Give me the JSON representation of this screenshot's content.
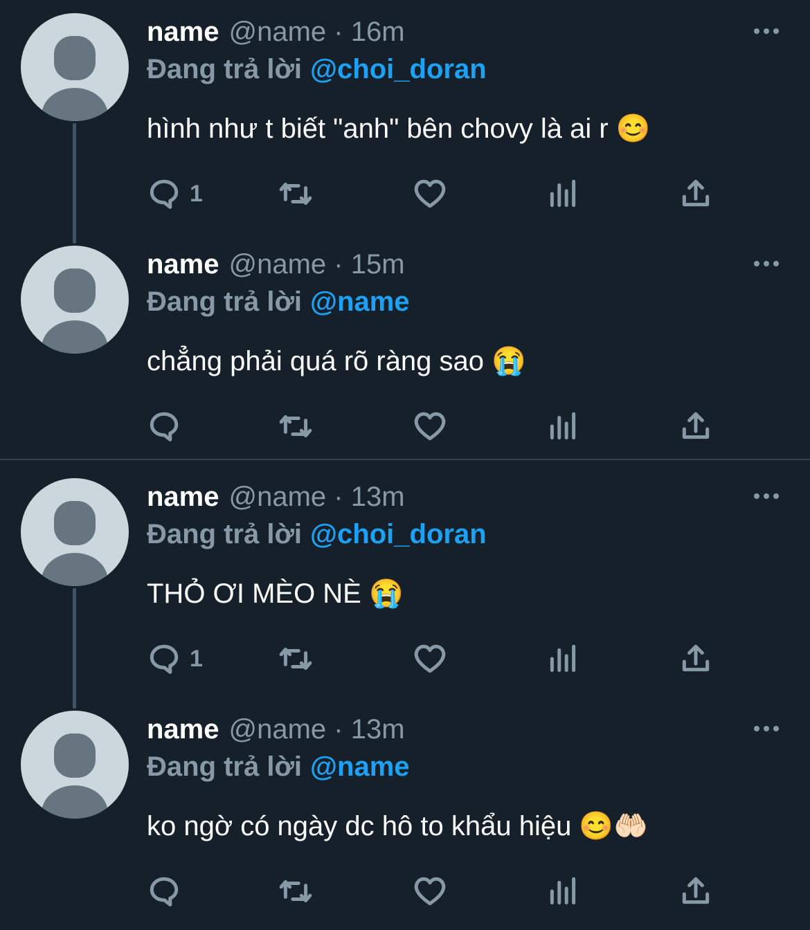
{
  "tweets": [
    {
      "name": "name",
      "meta": "@name · 16m",
      "reply_prefix": "Đang trả lời",
      "mention": "@choi_doran",
      "text": "hình như t biết \"anh\" bên chovy là ai r 😊",
      "reply_count": "1"
    },
    {
      "name": "name",
      "meta": "@name · 15m",
      "reply_prefix": "Đang trả lời",
      "mention": "@name",
      "text": "chẳng phải quá rõ ràng sao 😭",
      "reply_count": ""
    },
    {
      "name": "name",
      "meta": "@name · 13m",
      "reply_prefix": "Đang trả lời",
      "mention": "@choi_doran",
      "text": "THỎ ƠI MÈO NÈ 😭",
      "reply_count": "1"
    },
    {
      "name": "name",
      "meta": "@name · 13m",
      "reply_prefix": "Đang trả lời",
      "mention": "@name",
      "text": "ko ngờ có ngày dc hô to khẩu hiệu 😊🤲🏻",
      "reply_count": ""
    }
  ],
  "icons": {
    "reply": "reply-icon",
    "retweet": "retweet-icon",
    "like": "heart-icon",
    "stats": "analytics-icon",
    "share": "share-icon",
    "more": "more-icon"
  },
  "colors": {
    "background": "#15202b",
    "text_primary": "#ffffff",
    "text_secondary": "#8899a6",
    "mention": "#1da1f2",
    "divider": "#38444d",
    "thread_line": "#3d5466",
    "avatar_bg": "#ccd6dd",
    "avatar_fg": "#66757f"
  }
}
